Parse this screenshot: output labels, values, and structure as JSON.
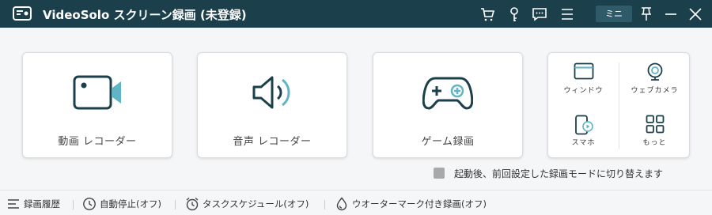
{
  "titlebar": {
    "app_title": "VideoSolo スクリーン録画 (未登録)",
    "mini_label": "ミニ",
    "icons": [
      "cart-icon",
      "key-icon",
      "feedback-icon",
      "menu-icon",
      "pin-icon",
      "minimize-icon",
      "close-icon"
    ]
  },
  "recorders": [
    {
      "label": "動画 レコーダー",
      "icon": "video-camera-icon"
    },
    {
      "label": "音声 レコーダー",
      "icon": "speaker-icon"
    },
    {
      "label": "ゲーム録画",
      "icon": "gamepad-icon"
    }
  ],
  "more_panel": {
    "items": [
      {
        "label": "ウィンドウ",
        "icon": "window-icon"
      },
      {
        "label": "ウェブカメラ",
        "icon": "webcam-icon"
      },
      {
        "label": "スマホ",
        "icon": "phone-icon"
      },
      {
        "label": "もっと",
        "icon": "grid-icon"
      }
    ]
  },
  "remember_mode": {
    "label": "起動後、前回設定した録画モードに切り替えます",
    "checked": false
  },
  "bottom_bar": {
    "items": [
      {
        "label": "録画履歴",
        "icon": "list-icon"
      },
      {
        "label": "自動停止(オフ)",
        "icon": "clock-icon"
      },
      {
        "label": "タスクスケジュール(オフ)",
        "icon": "alarm-icon"
      },
      {
        "label": "ウオーターマーク付き録画(オフ)",
        "icon": "drop-icon"
      }
    ]
  },
  "colors": {
    "titlebar": "#1c3f4c",
    "accent": "#1c3f4c",
    "accent_teal": "#5fb5c6",
    "background": "#f5f6f7"
  }
}
